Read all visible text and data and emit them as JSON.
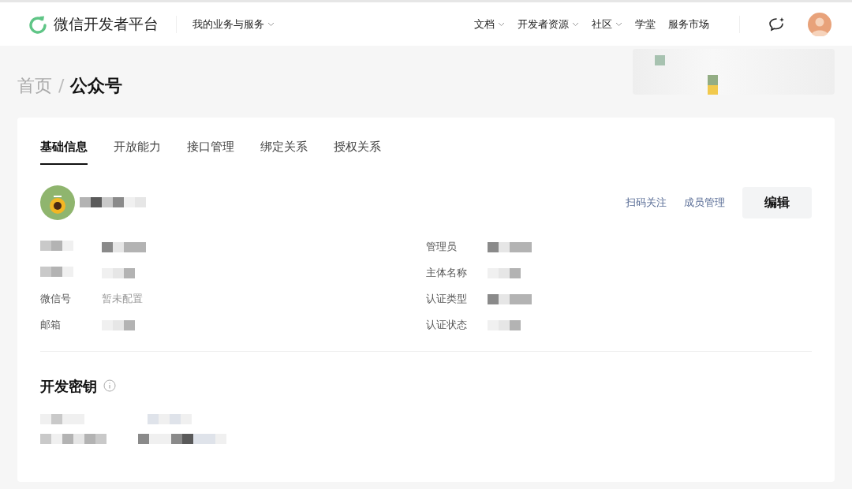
{
  "header": {
    "brand": "微信开发者平台",
    "menu": {
      "label": "我的业务与服务",
      "has_caret": true
    },
    "nav": [
      {
        "label": "文档",
        "has_caret": true
      },
      {
        "label": "开发者资源",
        "has_caret": true
      },
      {
        "label": "社区",
        "has_caret": true
      },
      {
        "label": "学堂",
        "has_caret": false
      },
      {
        "label": "服务市场",
        "has_caret": false
      }
    ]
  },
  "breadcrumb": {
    "separator": "/",
    "items": [
      {
        "label": "首页",
        "current": false
      },
      {
        "label": "公众号",
        "current": true
      }
    ]
  },
  "tabs": [
    {
      "label": "基础信息",
      "selected": true
    },
    {
      "label": "开放能力",
      "selected": false
    },
    {
      "label": "接口管理",
      "selected": false
    },
    {
      "label": "绑定关系",
      "selected": false
    },
    {
      "label": "授权关系",
      "selected": false
    }
  ],
  "account": {
    "links": [
      "扫码关注",
      "成员管理"
    ],
    "edit_button": "编辑"
  },
  "info_left": [
    {
      "kind": "redacted"
    },
    {
      "kind": "redacted"
    },
    {
      "kind": "field",
      "label": "微信号",
      "value": "暂未配置"
    },
    {
      "kind": "field",
      "label": "邮箱"
    }
  ],
  "info_right": [
    {
      "kind": "field",
      "label": "管理员"
    },
    {
      "kind": "field",
      "label": "主体名称"
    },
    {
      "kind": "field",
      "label": "认证类型"
    },
    {
      "kind": "field",
      "label": "认证状态"
    }
  ],
  "keys_section": {
    "title": "开发密钥"
  }
}
